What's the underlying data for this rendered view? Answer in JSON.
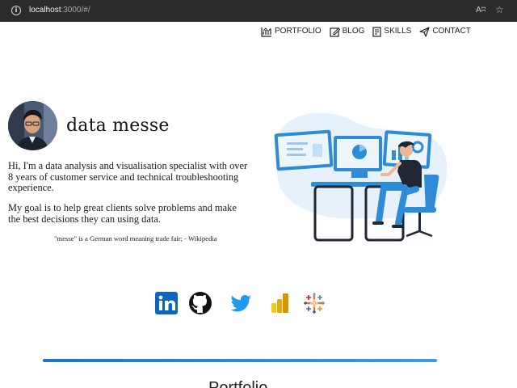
{
  "browser": {
    "url_host": "localhost",
    "url_rest": ":3000/#/",
    "info_icon": "info-icon",
    "read_aloud_label": "Aʭ",
    "favorites_icon": "star-plus-icon"
  },
  "nav": {
    "items": [
      {
        "label": "PORTFOLIO",
        "icon": "chart-icon"
      },
      {
        "label": "BLOG",
        "icon": "edit-icon"
      },
      {
        "label": "SKILLS",
        "icon": "document-icon"
      },
      {
        "label": "CONTACT",
        "icon": "send-icon"
      }
    ]
  },
  "hero": {
    "title": "data messe",
    "intro": "Hi, I'm a data analysis and visualisation specialist with over 8 years of customer service and technical troubleshooting experience.",
    "goal": "My goal is to help great clients solve problems and make the best decisions they can using data.",
    "quote": "\"messe\" is a German word meaning trade fair; - Wikipedia"
  },
  "socials": [
    {
      "name": "linkedin-icon",
      "color": "#0a66c2"
    },
    {
      "name": "github-icon",
      "color": "#111111"
    },
    {
      "name": "twitter-icon",
      "color": "#1d9bf0"
    },
    {
      "name": "powerbi-icon",
      "color": "#f2c811"
    },
    {
      "name": "tableau-icon",
      "color": "#e97627"
    }
  ],
  "colors": {
    "accent": "#1a76c8",
    "illustration_blue": "#2e8bd8",
    "blob": "#e6f1fb"
  },
  "sections": {
    "portfolio_heading": "Portfolio"
  }
}
